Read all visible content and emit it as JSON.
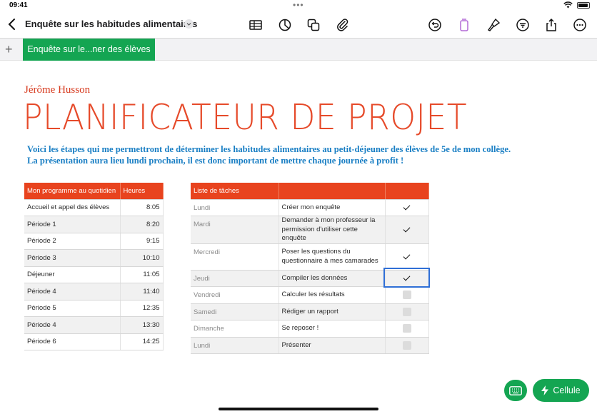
{
  "status_bar": {
    "time": "09:41",
    "dots": "•••"
  },
  "toolbar": {
    "doc_title": "Enquête sur les habitudes alimentaires",
    "icons": [
      "back-icon",
      "table-icon",
      "chart-icon",
      "shape-icon",
      "paperclip-icon",
      "undo-icon",
      "format-icon",
      "paintbrush-icon",
      "filter-icon",
      "share-icon",
      "more-icon"
    ]
  },
  "tabs": {
    "add": "+",
    "sheet_name": "Enquête sur le...ner des élèves"
  },
  "page": {
    "author": "Jérôme Husson",
    "heading": "PLANIFICATEUR DE PROJET",
    "intro_line1": "Voici les étapes qui me permettront de déterminer les habitudes alimentaires au petit-déjeuner des élèves de 5e de mon collège.",
    "intro_line2": "La présentation aura lieu lundi prochain, il est donc important de mettre chaque journée à profit   !"
  },
  "schedule": {
    "headers": [
      "Mon programme au quotidien",
      "Heures"
    ],
    "rows": [
      {
        "label": "Accueil et appel des élèves",
        "time": "8:05"
      },
      {
        "label": "Période 1",
        "time": "8:20"
      },
      {
        "label": "Période 2",
        "time": "9:15"
      },
      {
        "label": "Période 3",
        "time": "10:10"
      },
      {
        "label": "Déjeuner",
        "time": "11:05"
      },
      {
        "label": "Période 4",
        "time": "11:40"
      },
      {
        "label": "Période 5",
        "time": "12:35"
      },
      {
        "label": "Période 4",
        "time": "13:30"
      },
      {
        "label": "Période 6",
        "time": "14:25"
      }
    ]
  },
  "tasks": {
    "headers": [
      "Liste de tâches",
      "",
      ""
    ],
    "rows": [
      {
        "day": "Lundi",
        "task": "Créer mon enquête",
        "done": true
      },
      {
        "day": "Mardi",
        "task": "Demander à mon professeur la permission d'utiliser cette enquête",
        "done": true
      },
      {
        "day": "Mercredi",
        "task": "Poser les questions du questionnaire à mes camarades",
        "done": true
      },
      {
        "day": "Jeudi",
        "task": "Compiler les données",
        "done": true
      },
      {
        "day": "Vendredi",
        "task": "Calculer les résultats",
        "done": false
      },
      {
        "day": "Samedi",
        "task": "Rédiger un rapport",
        "done": false
      },
      {
        "day": "Dimanche",
        "task": "Se reposer !",
        "done": false
      },
      {
        "day": "Lundi",
        "task": "Présenter",
        "done": false
      }
    ]
  },
  "buttons": {
    "cell": "Cellule"
  },
  "colors": {
    "accent_green": "#14a552",
    "header_red": "#e8431e",
    "heading_red": "#e64a2a",
    "intro_blue": "#1a7fc4",
    "selection_blue": "#2f6fd6"
  }
}
